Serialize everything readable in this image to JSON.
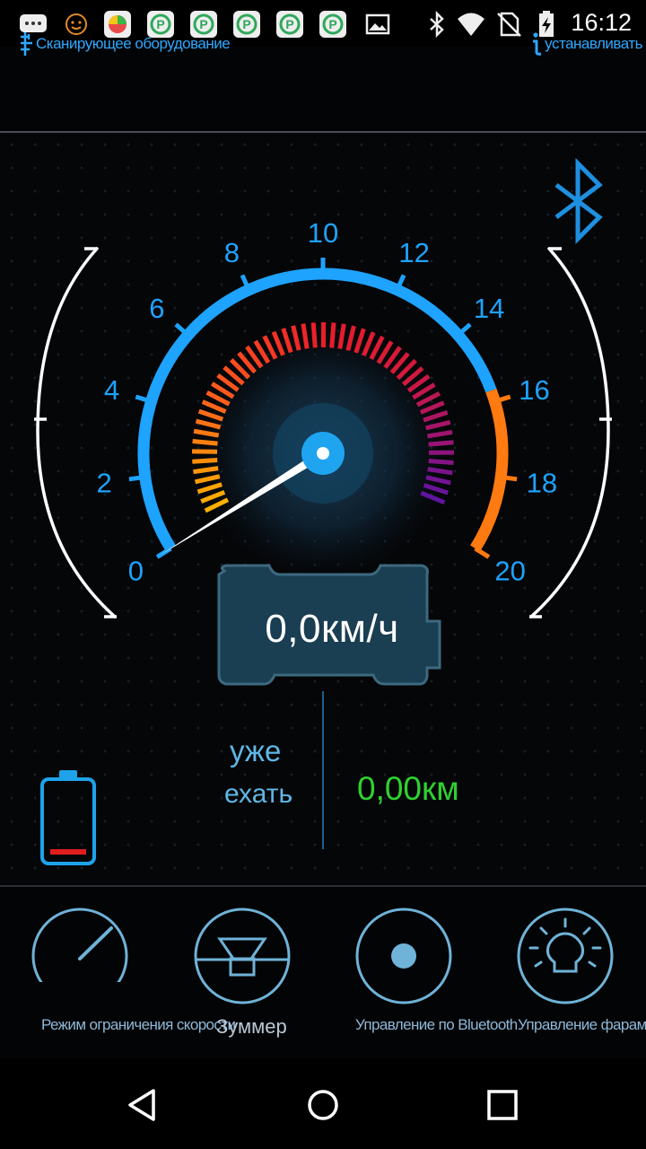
{
  "status_bar": {
    "time": "16:12",
    "icons": [
      "chat-icon",
      "emoji-icon",
      "app-icon",
      "p-app-icon",
      "p-app-icon",
      "p-app-icon",
      "p-app-icon",
      "image-icon",
      "bluetooth-icon",
      "wifi-icon",
      "no-sim-icon",
      "battery-charging-icon"
    ]
  },
  "header": {
    "scan_label": "Сканирующее оборудование",
    "settings_label": "устанавливать"
  },
  "gauge": {
    "ticks": [
      "0",
      "2",
      "4",
      "6",
      "8",
      "10",
      "12",
      "14",
      "16",
      "18",
      "20"
    ],
    "speed_value": 0,
    "speed_text": "0,0км/ч"
  },
  "info": {
    "label_line1": "уже",
    "label_line2": "ехать",
    "distance": "0,00км",
    "battery_level": 0.1
  },
  "controls": [
    {
      "label": "Режим ограничения скорости",
      "icon": "speedometer-icon"
    },
    {
      "label": "Зуммер",
      "icon": "horn-icon"
    },
    {
      "label": "Управление по Bluetooth",
      "icon": "bluetooth-dot-icon"
    },
    {
      "label": "Управление фарами",
      "icon": "headlight-icon"
    }
  ],
  "colors": {
    "accent": "#2fa8ff",
    "warning": "#ff7a10",
    "distance": "#2fd22f"
  },
  "nav": [
    "back-icon",
    "home-icon",
    "recents-icon"
  ]
}
